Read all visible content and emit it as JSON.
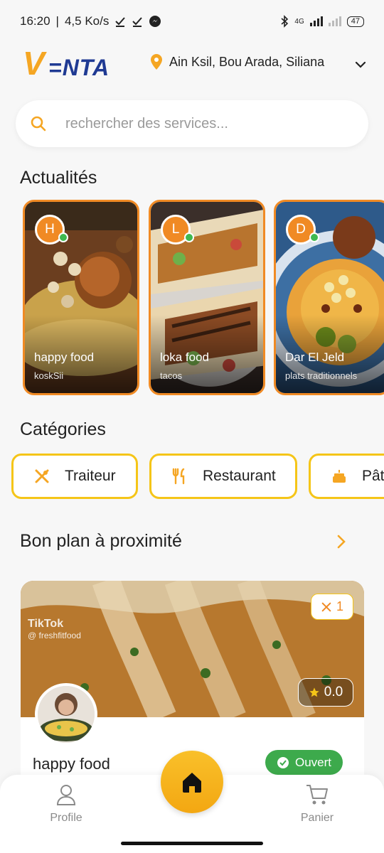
{
  "status_bar": {
    "time": "16:20",
    "speed": "4,5 Ko/s",
    "network": "4G",
    "battery": "47"
  },
  "header": {
    "logo_first": "V",
    "logo_rest": "=NTA",
    "location": "Ain Ksil, Bou Arada, Siliana"
  },
  "search": {
    "placeholder": "rechercher des services..."
  },
  "news": {
    "title": "Actualités",
    "stories": [
      {
        "initial": "H",
        "name": "happy food",
        "subtitle": "koskSii"
      },
      {
        "initial": "L",
        "name": "loka food",
        "subtitle": "tacos"
      },
      {
        "initial": "D",
        "name": "Dar El Jeld",
        "subtitle": "plats traditionnels"
      }
    ]
  },
  "categories": {
    "title": "Catégories",
    "items": [
      {
        "label": "Traiteur",
        "icon": "utensils-cross-icon"
      },
      {
        "label": "Restaurant",
        "icon": "fork-knife-icon"
      },
      {
        "label": "Pât",
        "icon": "cake-icon"
      }
    ]
  },
  "nearby": {
    "title": "Bon plan à proximité",
    "card": {
      "name": "happy food",
      "item_count": "1",
      "rating": "0.0",
      "status": "Ouvert",
      "watermark_brand": "TikTok",
      "watermark_handle": "@ freshfitfood"
    }
  },
  "bottom_nav": {
    "profile": "Profile",
    "cart": "Panier"
  },
  "colors": {
    "accent_orange": "#f08a24",
    "accent_yellow": "#f5c518",
    "brand_blue": "#1f3a93",
    "open_green": "#3daa4c"
  }
}
